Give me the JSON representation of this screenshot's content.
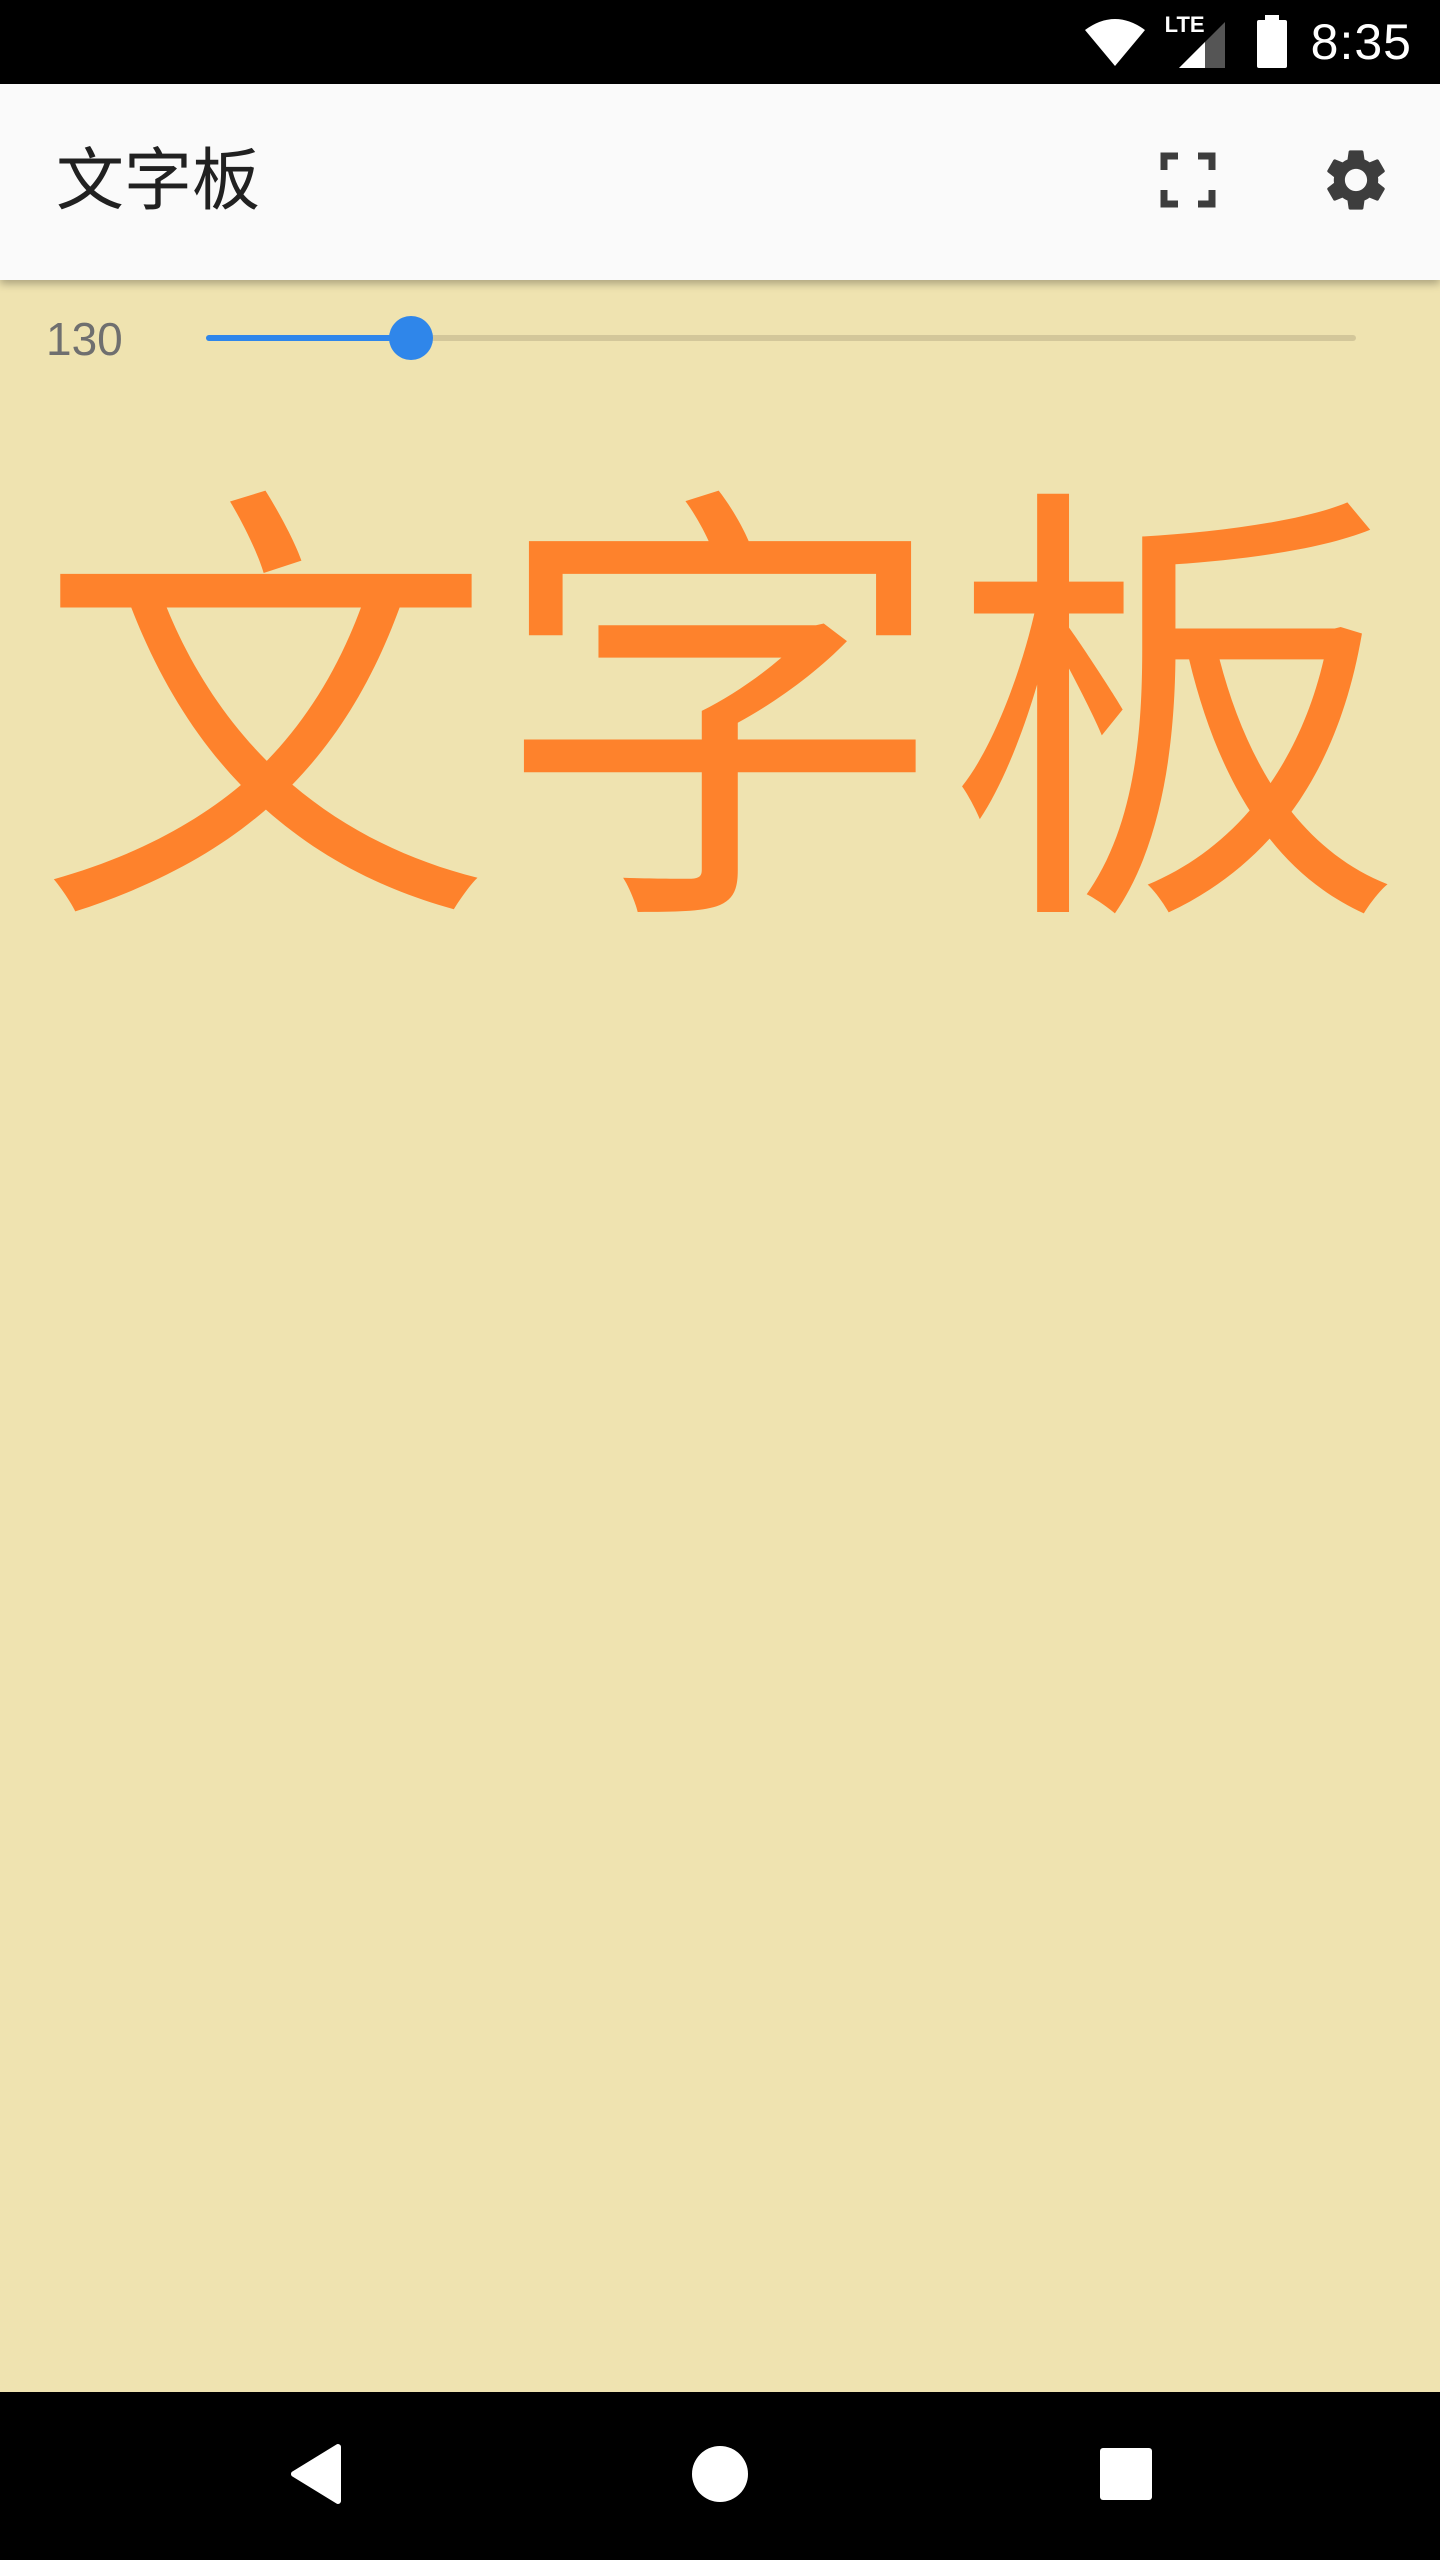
{
  "status_bar": {
    "time": "8:35",
    "network_label": "LTE",
    "icons": [
      "wifi-icon",
      "lte-signal-icon",
      "battery-icon"
    ]
  },
  "app_bar": {
    "title": "文字板",
    "actions": [
      {
        "name": "fullscreen-icon"
      },
      {
        "name": "gear-icon"
      }
    ]
  },
  "content": {
    "background_color": "#efe3b0",
    "text_color": "#fe822c",
    "size_value": "130",
    "slider_fraction": 0.178,
    "display_text": "文字板"
  },
  "colors": {
    "accent": "#2f86ea",
    "app_bar": "#fafafa"
  },
  "nav_bar": {
    "icons": [
      "back-icon",
      "home-icon",
      "recents-icon"
    ]
  }
}
